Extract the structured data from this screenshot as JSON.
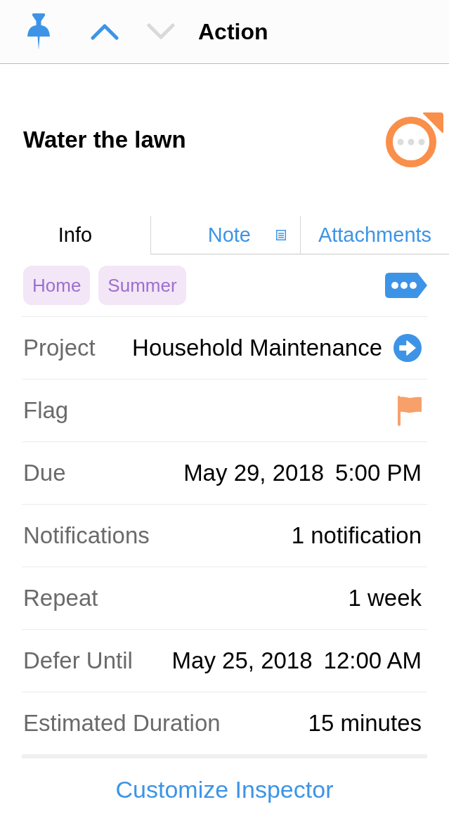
{
  "header": {
    "title": "Action",
    "nav": [
      {
        "kind": "up",
        "disabled": false
      },
      {
        "kind": "down",
        "disabled": true
      }
    ]
  },
  "task": {
    "title": "Water the lawn",
    "due_soon": true
  },
  "tabs": [
    {
      "label": "Info",
      "selected": true,
      "has_note": false
    },
    {
      "label": "Note",
      "selected": false,
      "has_note": true
    },
    {
      "label": "Attachments",
      "selected": false,
      "has_note": false
    }
  ],
  "tags": [
    {
      "label": "Home"
    },
    {
      "label": "Summer"
    }
  ],
  "rows": [
    {
      "kind": "link",
      "label": "Project",
      "value": "Household Maintenance"
    },
    {
      "kind": "flag",
      "label": "Flag",
      "flagged": true
    },
    {
      "kind": "datetime",
      "label": "Due",
      "date": "May 29, 2018",
      "time": "5:00 PM"
    },
    {
      "kind": "text",
      "label": "Notifications",
      "value": "1 notification"
    },
    {
      "kind": "text",
      "label": "Repeat",
      "value": "1 week"
    },
    {
      "kind": "datetime",
      "label": "Defer Until",
      "date": "May 25, 2018",
      "time": "12:00 AM"
    },
    {
      "kind": "text",
      "label": "Estimated Duration",
      "value": "15 minutes"
    }
  ],
  "footer": {
    "button": "Customize Inspector"
  }
}
